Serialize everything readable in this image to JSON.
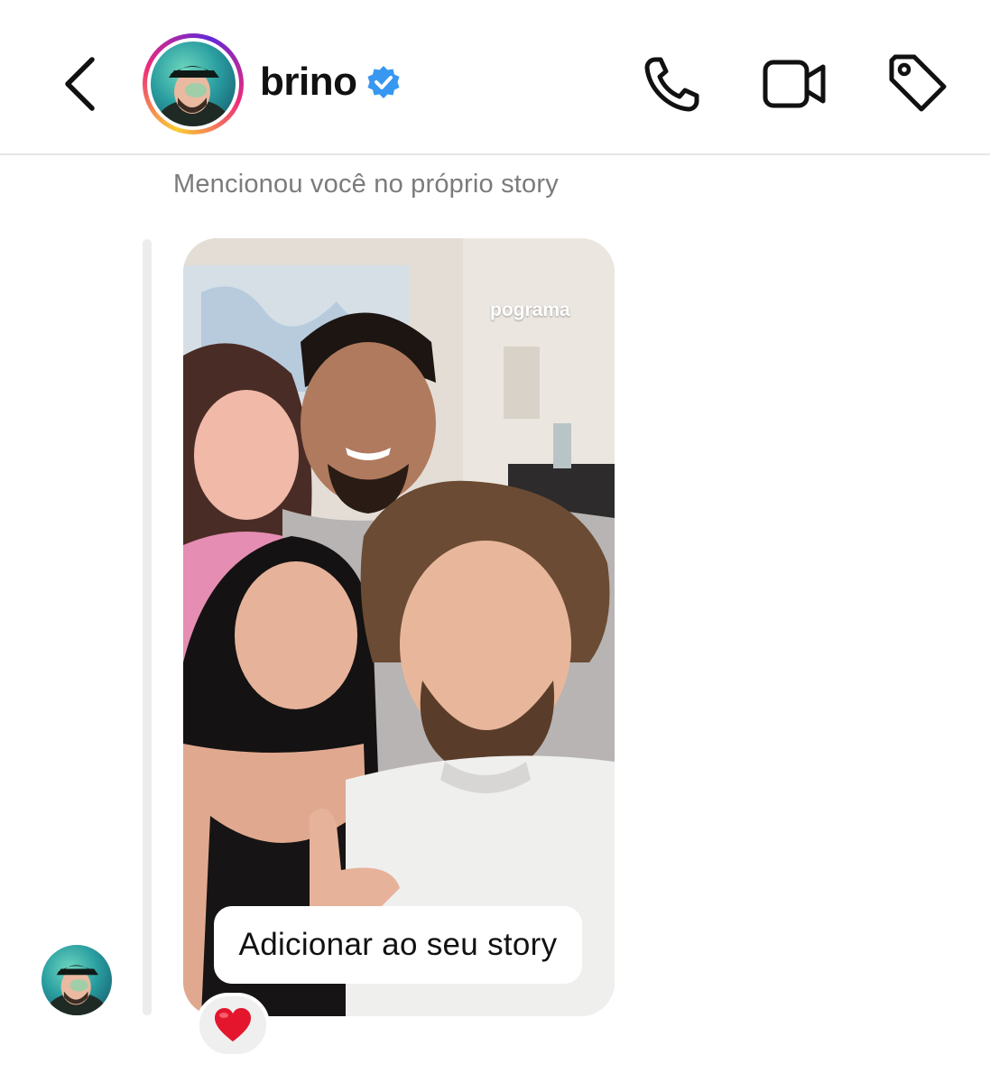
{
  "header": {
    "username": "brino",
    "verified": true,
    "icons": {
      "back": "chevron-left-icon",
      "call": "phone-icon",
      "video": "video-camera-icon",
      "tag": "tag-icon",
      "verified": "verified-badge-icon"
    },
    "colors": {
      "verified_blue": "#3897f0",
      "story_ring": [
        "#f9ce34",
        "#ee2a7b",
        "#6228d7"
      ]
    }
  },
  "message": {
    "mention_label": "Mencionou você no próprio story",
    "story": {
      "sticker_text": "pograma",
      "add_to_story_label": "Adicionar ao seu story"
    },
    "reaction": {
      "emoji": "❤️",
      "icon": "heart-icon"
    }
  }
}
